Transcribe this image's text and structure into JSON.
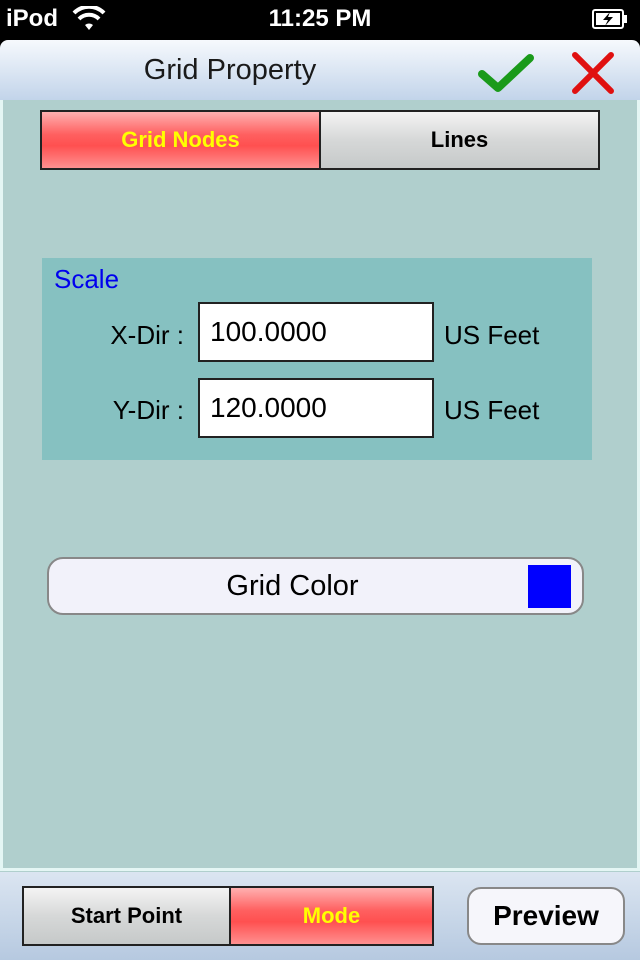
{
  "status_bar": {
    "carrier": "iPod",
    "time": "11:25 PM",
    "wifi_icon": "wifi-icon",
    "battery_icon": "battery-charging-icon"
  },
  "nav": {
    "title": "Grid Property",
    "confirm_icon": "checkmark-icon",
    "cancel_icon": "close-icon"
  },
  "tabs_top": {
    "items": [
      {
        "label": "Grid Nodes",
        "selected": true
      },
      {
        "label": "Lines",
        "selected": false
      }
    ]
  },
  "scale": {
    "title": "Scale",
    "x": {
      "label": "X-Dir :",
      "value": "100.0000",
      "unit": "US Feet"
    },
    "y": {
      "label": "Y-Dir :",
      "value": "120.0000",
      "unit": "US Feet"
    }
  },
  "grid_color": {
    "label": "Grid Color",
    "color": "#0000ff"
  },
  "bottom": {
    "tabs": [
      {
        "label": "Start Point",
        "selected": false
      },
      {
        "label": "Mode",
        "selected": true
      }
    ],
    "preview_label": "Preview"
  },
  "colors": {
    "accent_active": "#ff5a5a",
    "active_text": "#ffff00",
    "content_bg": "#b0cfcd",
    "panel_bg": "#86c1c1",
    "check": "#1a9a1a",
    "close": "#e01010"
  }
}
